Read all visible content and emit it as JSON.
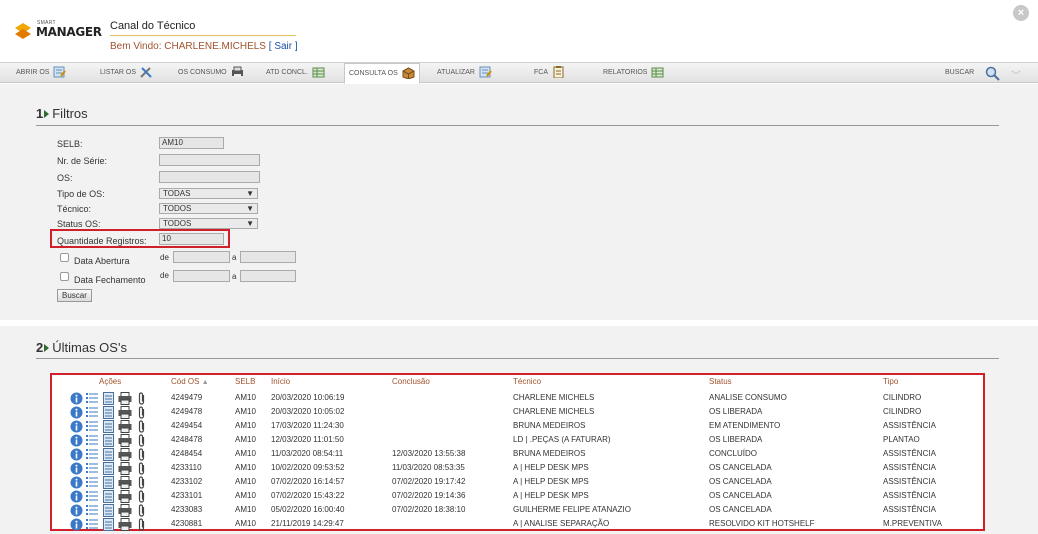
{
  "header": {
    "logo_small": "SMART",
    "logo_big": "MANAGER",
    "title": "Canal do Técnico",
    "welcome": "Bem Vindo: CHARLENE.MICHELS",
    "sair": "[ Sair ]"
  },
  "nav": {
    "items": [
      {
        "label": "ABRIR OS",
        "icon": "form-edit-icon"
      },
      {
        "label": "LISTAR OS",
        "icon": "tools-icon"
      },
      {
        "label": "OS CONSUMO",
        "icon": "printer-icon"
      },
      {
        "label": "ATD CONCL.",
        "icon": "table-icon"
      },
      {
        "label": "CONSULTA OS",
        "icon": "box-icon"
      },
      {
        "label": "ATUALIZAR",
        "icon": "form-edit-icon"
      },
      {
        "label": "FCA",
        "icon": "clipboard-icon"
      },
      {
        "label": "RELATORIOS",
        "icon": "table-icon"
      }
    ],
    "buscar": "BUSCAR"
  },
  "filters": {
    "section_num": "1",
    "section_title": "Filtros",
    "selb_label": "SELB:",
    "selb_value": "AM10",
    "serie_label": "Nr. de Série:",
    "os_label": "OS:",
    "tipo_label": "Tipo de OS:",
    "tipo_value": "TODAS",
    "tecnico_label": "Técnico:",
    "tecnico_value": "TODOS",
    "status_label": "Status OS:",
    "status_value": "TODOS",
    "qtd_label": "Quantidade Registros:",
    "qtd_value": "10",
    "abertura_label": "Data Abertura",
    "fechamento_label": "Data Fechamento",
    "de": "de",
    "a": "a",
    "buscar_btn": "Buscar"
  },
  "results": {
    "section_num": "2",
    "section_title": "Últimas OS's",
    "columns": [
      "Ações",
      "Cód OS",
      "SELB",
      "Início",
      "Conclusão",
      "Técnico",
      "Status",
      "Tipo"
    ],
    "rows": [
      {
        "cod": "4249479",
        "selb": "AM10",
        "inicio": "20/03/2020 10:06:19",
        "conclusao": "",
        "tecnico": "CHARLENE MICHELS",
        "status": "ANALISE CONSUMO",
        "tipo": "CILINDRO"
      },
      {
        "cod": "4249478",
        "selb": "AM10",
        "inicio": "20/03/2020 10:05:02",
        "conclusao": "",
        "tecnico": "CHARLENE MICHELS",
        "status": "OS LIBERADA",
        "tipo": "CILINDRO"
      },
      {
        "cod": "4249454",
        "selb": "AM10",
        "inicio": "17/03/2020 11:24:30",
        "conclusao": "",
        "tecnico": "BRUNA MEDEIROS",
        "status": "EM ATENDIMENTO",
        "tipo": "ASSISTÊNCIA"
      },
      {
        "cod": "4248478",
        "selb": "AM10",
        "inicio": "12/03/2020 11:01:50",
        "conclusao": "",
        "tecnico": "LD | .PEÇAS (A FATURAR)",
        "status": "OS LIBERADA",
        "tipo": "PLANTAO"
      },
      {
        "cod": "4248454",
        "selb": "AM10",
        "inicio": "11/03/2020 08:54:11",
        "conclusao": "12/03/2020 13:55:38",
        "tecnico": "BRUNA MEDEIROS",
        "status": "CONCLUÍDO",
        "tipo": "ASSISTÊNCIA"
      },
      {
        "cod": "4233110",
        "selb": "AM10",
        "inicio": "10/02/2020 09:53:52",
        "conclusao": "11/03/2020 08:53:35",
        "tecnico": "A | HELP DESK MPS",
        "status": "OS CANCELADA",
        "tipo": "ASSISTÊNCIA"
      },
      {
        "cod": "4233102",
        "selb": "AM10",
        "inicio": "07/02/2020 16:14:57",
        "conclusao": "07/02/2020 19:17:42",
        "tecnico": "A | HELP DESK MPS",
        "status": "OS CANCELADA",
        "tipo": "ASSISTÊNCIA"
      },
      {
        "cod": "4233101",
        "selb": "AM10",
        "inicio": "07/02/2020 15:43:22",
        "conclusao": "07/02/2020 19:14:36",
        "tecnico": "A | HELP DESK MPS",
        "status": "OS CANCELADA",
        "tipo": "ASSISTÊNCIA"
      },
      {
        "cod": "4233083",
        "selb": "AM10",
        "inicio": "05/02/2020 16:00:40",
        "conclusao": "07/02/2020 18:38:10",
        "tecnico": "GUILHERME FELIPE ATANAZIO",
        "status": "OS CANCELADA",
        "tipo": "ASSISTÊNCIA"
      },
      {
        "cod": "4230881",
        "selb": "AM10",
        "inicio": "21/11/2019 14:29:47",
        "conclusao": "",
        "tecnico": "A | ANALISE SEPARAÇÃO",
        "status": "RESOLVIDO KIT HOTSHELF",
        "tipo": "M.PREVENTIVA"
      }
    ],
    "row_actions": [
      "info-icon",
      "list-icon",
      "document-icon",
      "print-icon",
      "attachment-icon"
    ]
  },
  "colors": {
    "highlight": "#d0202a",
    "accent_brown": "#a0522d",
    "link_blue": "#1a4fa8"
  }
}
